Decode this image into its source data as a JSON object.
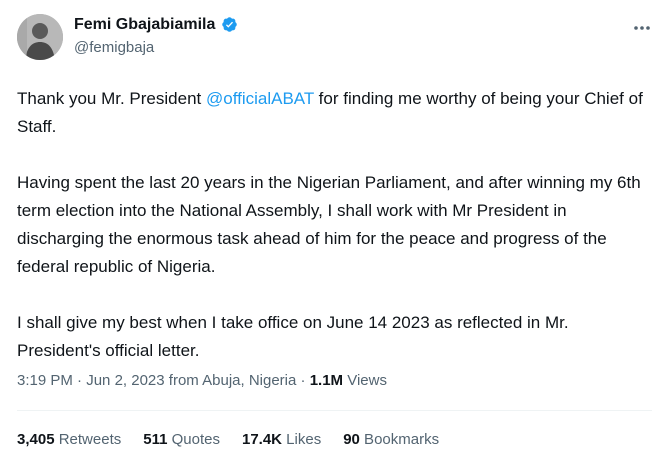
{
  "author": {
    "display_name": "Femi Gbajabiamila",
    "handle": "@femigbaja",
    "verified": true,
    "avatar_icon": "profile-photo"
  },
  "more_icon": "ellipsis-horizontal-icon",
  "tweet": {
    "p1_before": "Thank you Mr. President ",
    "p1_mention": "@officialABAT",
    "p1_after": " for finding me worthy of being your Chief of Staff.",
    "p2": "Having spent the last 20 years in the Nigerian Parliament, and after winning my 6th term election into the National Assembly, I shall work with Mr President in discharging the enormous task ahead of him for the peace and progress of the federal republic of Nigeria.",
    "p3": "I shall give my best when I take office on June 14 2023 as reflected in Mr. President's official letter."
  },
  "meta": {
    "time": "3:19 PM",
    "sep1": " · ",
    "date": "Jun 2, 2023",
    "location": " from Abuja, Nigeria",
    "sep2": " · ",
    "views_count": "1.1M",
    "views_label": " Views"
  },
  "stats": {
    "retweets_count": "3,405",
    "retweets_label": " Retweets",
    "quotes_count": "511",
    "quotes_label": " Quotes",
    "likes_count": "17.4K",
    "likes_label": " Likes",
    "bookmarks_count": "90",
    "bookmarks_label": " Bookmarks"
  },
  "colors": {
    "accent": "#1d9bf0",
    "text": "#0f1419",
    "secondary": "#536471",
    "divider": "#eff3f4"
  }
}
